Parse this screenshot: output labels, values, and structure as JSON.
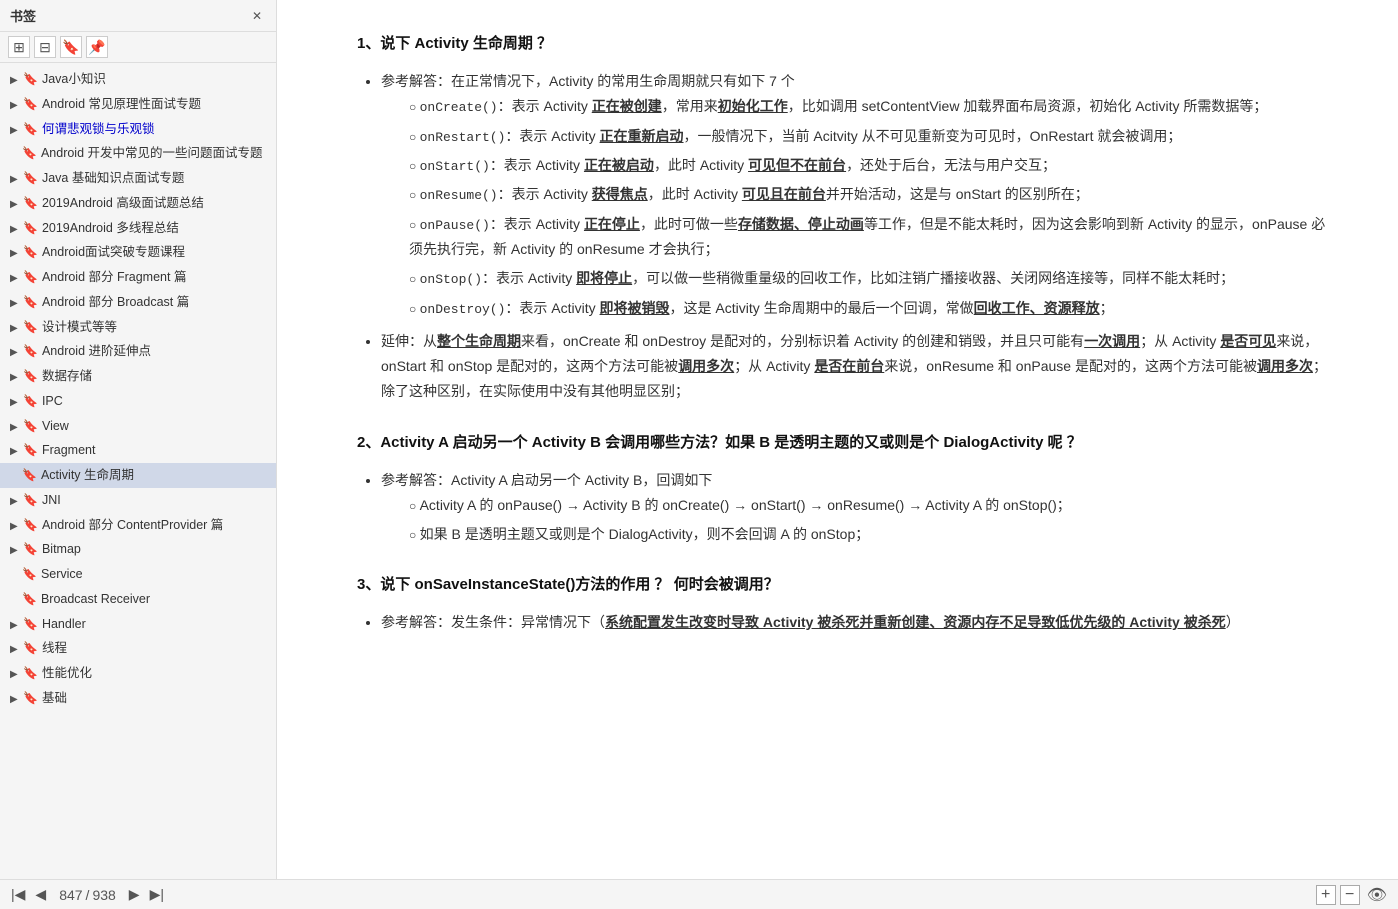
{
  "sidebar": {
    "title": "书签",
    "items": [
      {
        "id": "java-knowledge",
        "label": "Java小知识",
        "level": 0,
        "hasArrow": true,
        "active": false
      },
      {
        "id": "android-interview",
        "label": "Android 常见原理性面试专题",
        "level": 0,
        "hasArrow": true,
        "active": false
      },
      {
        "id": "pessimistic-optimistic",
        "label": "何谓悲观锁与乐观锁",
        "level": 0,
        "hasArrow": true,
        "active": false,
        "highlighted": true
      },
      {
        "id": "android-common-interview",
        "label": "Android 开发中常见的一些问题面试专题",
        "level": 1,
        "hasArrow": false,
        "active": false
      },
      {
        "id": "java-basics",
        "label": "Java 基础知识点面试专题",
        "level": 0,
        "hasArrow": true,
        "active": false
      },
      {
        "id": "android-2019-advanced",
        "label": "2019Android 高级面试题总结",
        "level": 0,
        "hasArrow": true,
        "active": false
      },
      {
        "id": "android-2019-multithread",
        "label": "2019Android 多线程总结",
        "level": 0,
        "hasArrow": true,
        "active": false
      },
      {
        "id": "android-interview-course",
        "label": "Android面试突破专题课程",
        "level": 0,
        "hasArrow": true,
        "active": false
      },
      {
        "id": "android-fragment",
        "label": "Android 部分 Fragment 篇",
        "level": 0,
        "hasArrow": true,
        "active": false
      },
      {
        "id": "android-broadcast",
        "label": "Android 部分 Broadcast 篇",
        "level": 0,
        "hasArrow": true,
        "active": false
      },
      {
        "id": "design-patterns",
        "label": "设计模式等等",
        "level": 0,
        "hasArrow": true,
        "active": false
      },
      {
        "id": "android-extension",
        "label": "Android 进阶延伸点",
        "level": 0,
        "hasArrow": true,
        "active": false
      },
      {
        "id": "data-storage",
        "label": "数据存储",
        "level": 0,
        "hasArrow": true,
        "active": false
      },
      {
        "id": "ipc",
        "label": "IPC",
        "level": 0,
        "hasArrow": true,
        "active": false
      },
      {
        "id": "view",
        "label": "View",
        "level": 0,
        "hasArrow": true,
        "active": false
      },
      {
        "id": "fragment",
        "label": "Fragment",
        "level": 0,
        "hasArrow": true,
        "active": false
      },
      {
        "id": "activity-lifecycle",
        "label": "Activity 生命周期",
        "level": 1,
        "hasArrow": false,
        "active": true
      },
      {
        "id": "jni",
        "label": "JNI",
        "level": 0,
        "hasArrow": true,
        "active": false
      },
      {
        "id": "android-contentprovider",
        "label": "Android 部分 ContentProvider 篇",
        "level": 0,
        "hasArrow": true,
        "active": false
      },
      {
        "id": "bitmap",
        "label": "Bitmap",
        "level": 0,
        "hasArrow": true,
        "active": false
      },
      {
        "id": "service",
        "label": "Service",
        "level": 1,
        "hasArrow": false,
        "active": false
      },
      {
        "id": "broadcast-receiver",
        "label": "Broadcast Receiver",
        "level": 1,
        "hasArrow": false,
        "active": false
      },
      {
        "id": "handler",
        "label": "Handler",
        "level": 0,
        "hasArrow": true,
        "active": false
      },
      {
        "id": "thread",
        "label": "线程",
        "level": 0,
        "hasArrow": true,
        "active": false
      },
      {
        "id": "performance",
        "label": "性能优化",
        "level": 0,
        "hasArrow": true,
        "active": false
      },
      {
        "id": "basics",
        "label": "基础",
        "level": 0,
        "hasArrow": true,
        "active": false
      }
    ]
  },
  "bottom": {
    "page_current": "847",
    "page_total": "938"
  },
  "content": {
    "q1_title": "1、说下 Activity 生命周期 ？",
    "q1_answer_intro": "参考解答：在正常情况下，Activity 的常用生命周期就只有如下 7 个",
    "q1_items": [
      {
        "method": "onCreate()",
        "desc_pre": "：表示 Activity ",
        "desc_bold": "正在被创建",
        "desc_post": "，常用来",
        "desc_bold2": "初始化工作",
        "desc_post2": "，比如调用 setContentView 加载界面布局资源，初始化 Activity 所需数据等；"
      },
      {
        "method": "onRestart()",
        "desc_pre": "：表示 Activity ",
        "desc_bold": "正在重新启动",
        "desc_post": "，一般情况下，当前 Acitvity 从不可见重新变为可见时，OnRestart 就会被调用；"
      },
      {
        "method": "onStart()",
        "desc_pre": "：表示 Activity ",
        "desc_bold": "正在被启动",
        "desc_post": "，此时 Activity ",
        "desc_bold2": "可见但不在前台",
        "desc_post2": "，还处于后台，无法与用户交互；"
      },
      {
        "method": "onResume()",
        "desc_pre": "：表示 Activity ",
        "desc_bold": "获得焦点",
        "desc_post": "，此时 Activity ",
        "desc_bold2": "可见且在前台",
        "desc_post2": "并开始活动，这是与 onStart 的区别所在；"
      },
      {
        "method": "onPause()",
        "desc_pre": "：表示 Activity ",
        "desc_bold": "正在停止",
        "desc_post": "，此时可做一些",
        "desc_bold2": "存储数据、停止动画",
        "desc_post2": "等工作，但是不能太耗时，因为这会影响到新 Activity 的显示，onPause 必须先执行完，新 Activity 的 onResume 才会执行；"
      },
      {
        "method": "onStop()",
        "desc_pre": "：表示 Activity ",
        "desc_bold": "即将停止",
        "desc_post": "，可以做一些稍微重量级的回收工作，比如注销广播接收器、关闭网络连接等，同样不能太耗时；"
      },
      {
        "method": "onDestroy()",
        "desc_pre": "：表示 Activity ",
        "desc_bold": "即将被销毁",
        "desc_post": "，这是 Activity 生命周期中的最后一个回调，常做",
        "desc_bold2": "回收工作、资源释放",
        "desc_post2": "；"
      }
    ],
    "q1_extension": "延伸：从整个生命周期来看，onCreate 和 onDestroy 是配对的，分别标识着 Activity 的创建和销毁，并且只可能有一次调用；从 Activity 是否可见来说，onStart 和 onStop 是配对的，这两个方法可能被调用多次；从 Activity 是否在前台来说，onResume 和 onPause 是配对的，这两个方法可能被调用多次；除了这种区别，在实际使用中没有其他明显区别；",
    "q2_title": "2、Activity A 启动另一个 Activity B 会调用哪些方法？如果 B 是透明主题的又或则是个 DialogActivity 呢 ？",
    "q2_answer_intro": "参考解答：Activity A 启动另一个 Activity B，回调如下",
    "q2_items": [
      "Activity A 的 onPause() → Activity B 的 onCreate() → onStart() → onResume() → Activity A 的 onStop()；",
      "如果 B 是透明主题又或则是个 DialogActivity，则不会回调 A 的 onStop；"
    ],
    "q3_title": "3、说下 onSaveInstanceState()方法的作用 ？ 何时会被调用？",
    "q3_answer_intro": "参考解答：发生条件：异常情况下（系统配置发生改变时导致 Activity 被杀死并重新创建、资源内存不足导致低优先级的 Activity 被杀死）"
  }
}
